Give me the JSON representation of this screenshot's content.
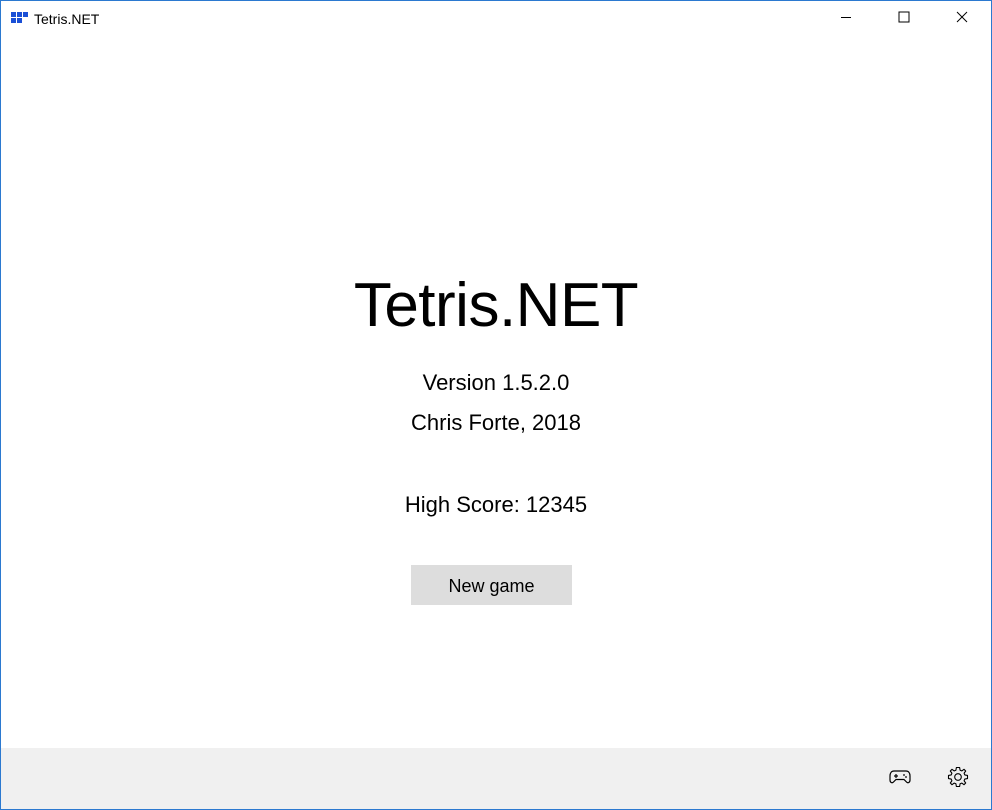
{
  "window": {
    "title": "Tetris.NET",
    "app_icon": "tetris-block-icon",
    "controls": {
      "minimize_icon": "minimize-icon",
      "maximize_icon": "maximize-icon",
      "close_icon": "close-icon"
    }
  },
  "main": {
    "title": "Tetris.NET",
    "version": "Version 1.5.2.0",
    "author": "Chris Forte, 2018",
    "high_score": "High Score: 12345",
    "new_game_label": "New game"
  },
  "bottom_bar": {
    "controller_icon": "game-controller-icon",
    "settings_icon": "gear-icon"
  },
  "colors": {
    "window_border": "#2b79d0",
    "app_icon_blue": "#1a4fd6",
    "button_bg": "#dddddd",
    "bottom_bar_bg": "#f0f0f0"
  }
}
